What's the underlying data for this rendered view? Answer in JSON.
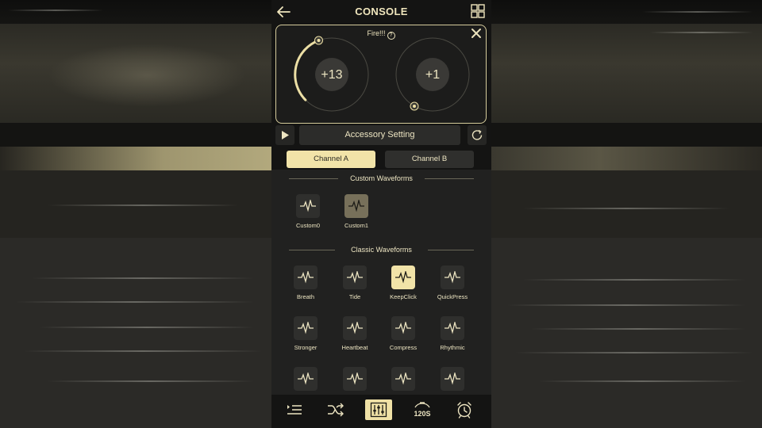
{
  "header": {
    "title": "CONSOLE"
  },
  "fire": {
    "label": "Fire!!!",
    "help": "?",
    "channel_a_value": "+13",
    "channel_b_value": "+1"
  },
  "accessory": {
    "label": "Accessory Setting"
  },
  "channels": {
    "a_label": "Channel A",
    "b_label": "Channel B",
    "selected": "Channel A"
  },
  "custom_waveforms": {
    "title": "Custom Waveforms",
    "items": [
      {
        "label": "Custom0"
      },
      {
        "label": "Custom1"
      }
    ]
  },
  "classic_waveforms": {
    "title": "Classic Waveforms",
    "items": [
      {
        "label": "Breath"
      },
      {
        "label": "Tide"
      },
      {
        "label": "KeepClick"
      },
      {
        "label": "QuickPress"
      },
      {
        "label": "Stronger"
      },
      {
        "label": "Heartbeat"
      },
      {
        "label": "Compress"
      },
      {
        "label": "Rhythmic"
      }
    ]
  },
  "bottom_nav": {
    "timer_label": "120S"
  },
  "colors": {
    "accent": "#f1e3a8",
    "text": "#ede5c2",
    "panel": "#212120",
    "background": "#141413"
  }
}
